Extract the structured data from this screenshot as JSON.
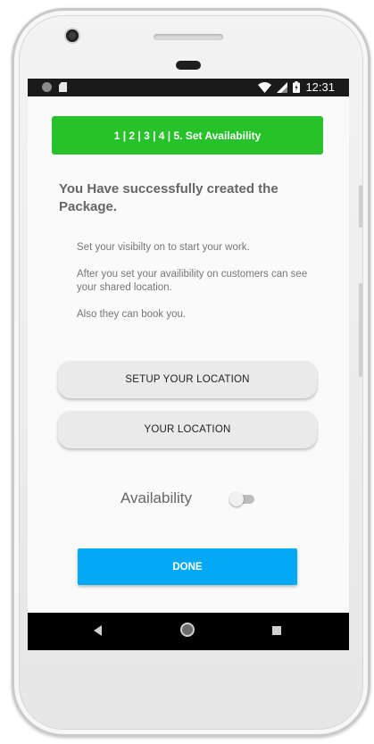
{
  "status_bar": {
    "time": "12:31",
    "icons": [
      "notification-dot-icon",
      "sd-card-icon",
      "wifi-icon",
      "signal-icon",
      "battery-icon"
    ]
  },
  "step_banner": {
    "label": "1 | 2 | 3 | 4 | 5. Set Availability",
    "color": "#27c22a"
  },
  "headline": "You Have successfully created the Package.",
  "paragraphs": [
    "Set your visibilty on to start your  work.",
    "After you set your availibility on  customers can see your shared location.",
    "Also they can book you."
  ],
  "buttons": {
    "setup_location": "SETUP YOUR LOCATION",
    "your_location": "YOUR LOCATION",
    "done": "DONE"
  },
  "availability": {
    "label": "Availability",
    "enabled": false
  },
  "colors": {
    "done_button": "#03a9f4",
    "banner": "#27c22a"
  },
  "nav_bar": {
    "icons": [
      "back-icon",
      "home-icon",
      "recents-icon"
    ]
  }
}
